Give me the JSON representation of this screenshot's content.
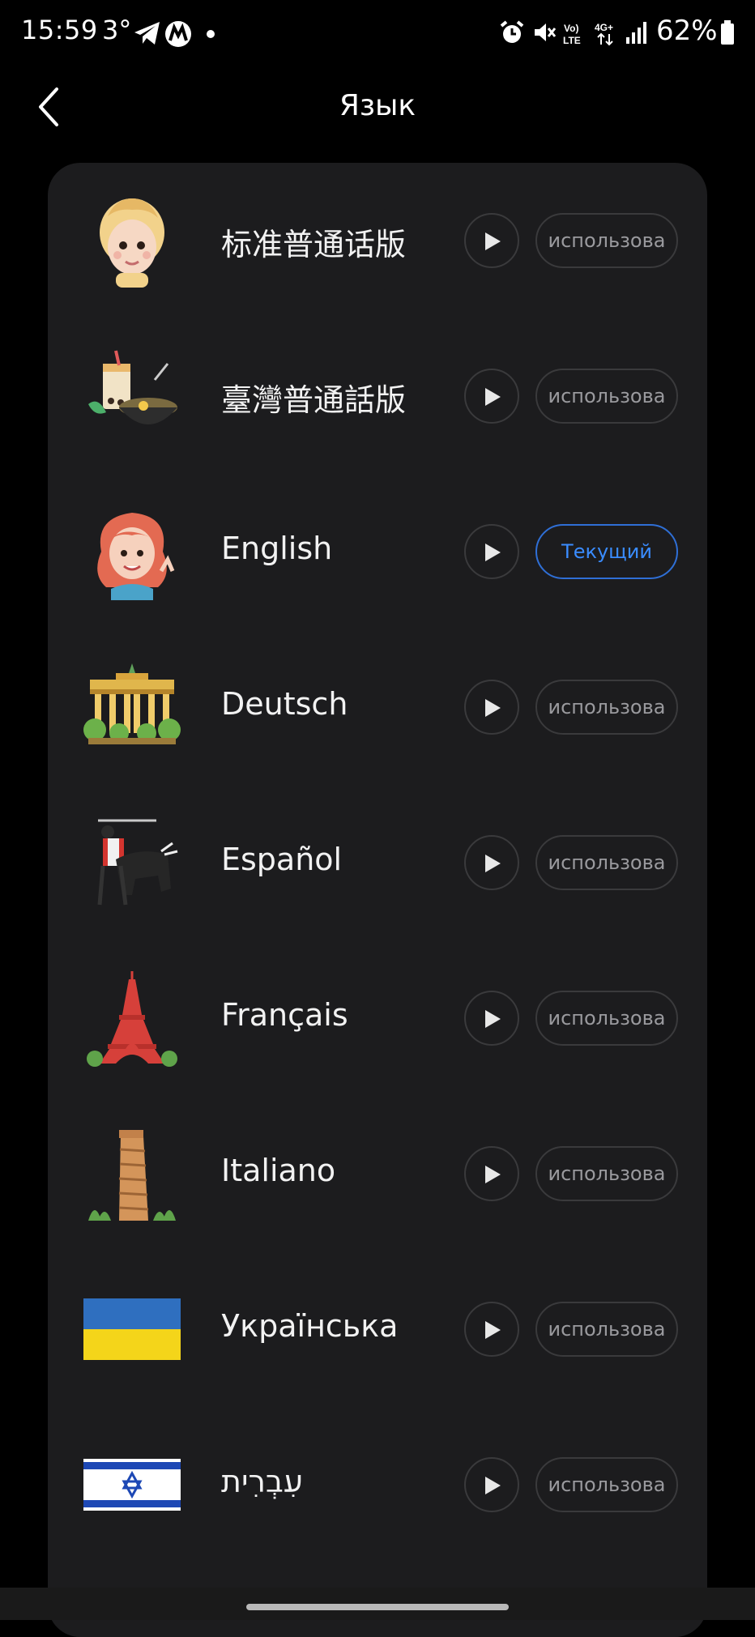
{
  "status_bar": {
    "time": "15:59",
    "temperature": "3°",
    "battery": "62%",
    "icons": [
      "telegram-icon",
      "app-icon",
      "dot-icon",
      "alarm-icon",
      "mute-icon",
      "volte-icon",
      "4g-icon",
      "signal-icon",
      "battery-icon"
    ]
  },
  "header": {
    "title": "Язык",
    "back_icon": "chevron-left-icon"
  },
  "languages": [
    {
      "label": "标准普通话版",
      "button": "использова",
      "current": false,
      "illustration": "blonde-avatar"
    },
    {
      "label": "臺灣普通話版",
      "button": "использова",
      "current": false,
      "illustration": "bubble-tea-noodles"
    },
    {
      "label": "English",
      "button": "Текущий",
      "current": true,
      "illustration": "redhead-avatar"
    },
    {
      "label": "Deutsch",
      "button": "использова",
      "current": false,
      "illustration": "brandenburg-gate"
    },
    {
      "label": "Español",
      "button": "использова",
      "current": false,
      "illustration": "matador-bull"
    },
    {
      "label": "Français",
      "button": "использова",
      "current": false,
      "illustration": "eiffel-tower"
    },
    {
      "label": "Italiano",
      "button": "использова",
      "current": false,
      "illustration": "leaning-tower-pisa"
    },
    {
      "label": "Українська",
      "button": "использова",
      "current": false,
      "illustration": "ukraine-flag"
    },
    {
      "label": "עִבְרִית",
      "button": "использова",
      "current": false,
      "illustration": "israel-flag"
    }
  ],
  "colors": {
    "background": "#000000",
    "card": "#1c1c1e",
    "accent": "#3a8cff",
    "button_border": "#3a3a3c",
    "button_text": "#9a9a9e"
  }
}
